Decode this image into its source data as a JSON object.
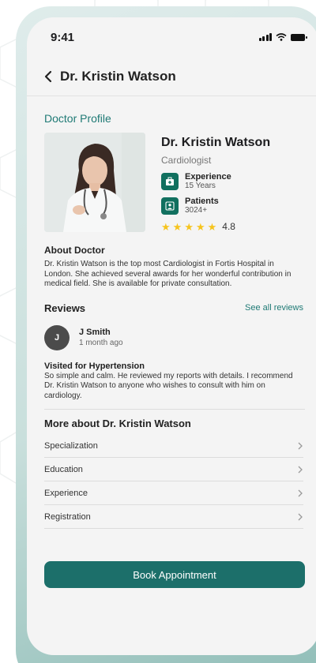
{
  "status": {
    "time": "9:41"
  },
  "nav": {
    "title": "Dr. Kristin Watson"
  },
  "profile": {
    "section_title": "Doctor Profile",
    "name": "Dr. Kristin Watson",
    "specialty": "Cardiologist",
    "experience_label": "Experience",
    "experience_value": "15 Years",
    "patients_label": "Patients",
    "patients_value": "3024+",
    "rating_value": "4.8",
    "rating_stars": 5
  },
  "about": {
    "heading": "About Doctor",
    "text": "Dr. Kristin Watson is the top most Cardiologist in Fortis Hospital in London. She achieved several awards for her wonderful contribution in medical field. She is available for private consultation."
  },
  "reviews": {
    "heading": "Reviews",
    "see_all": "See all reviews",
    "items": [
      {
        "avatar_initial": "J",
        "name": "J Smith",
        "time": "1 month ago",
        "title": "Visited for Hypertension",
        "text": "So simple and calm. He reviewed my reports with details. I recommend Dr. Kristin Watson to anyone who wishes to consult with him on cardiology."
      }
    ]
  },
  "more": {
    "heading": "More about Dr. Kristin Watson",
    "items": [
      {
        "label": "Specialization"
      },
      {
        "label": "Education"
      },
      {
        "label": "Experience"
      },
      {
        "label": "Registration"
      }
    ]
  },
  "cta": {
    "label": "Book Appointment"
  },
  "colors": {
    "accent": "#1c6f6a",
    "link": "#1f7a75",
    "star": "#f6c41d",
    "stat_icon_bg": "#11705f"
  }
}
